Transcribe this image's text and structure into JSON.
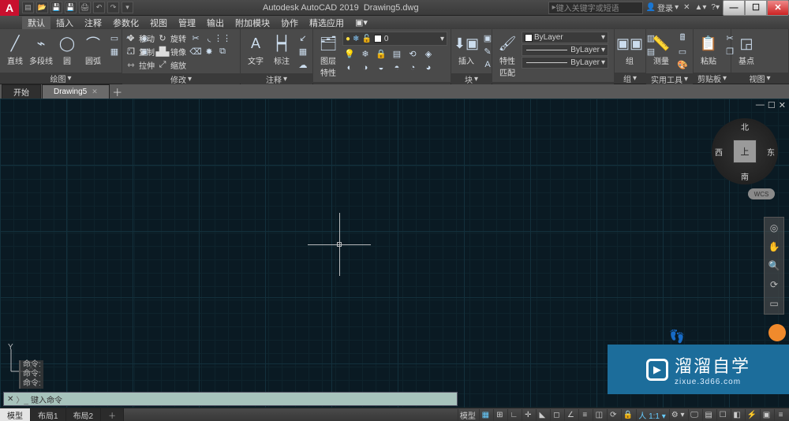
{
  "title": {
    "app": "Autodesk AutoCAD 2019",
    "doc": "Drawing5.dwg"
  },
  "search": {
    "placeholder": "键入关键字或短语"
  },
  "user": {
    "login": "登录"
  },
  "menubar": [
    "默认",
    "插入",
    "注释",
    "参数化",
    "视图",
    "管理",
    "输出",
    "附加模块",
    "协作",
    "精选应用"
  ],
  "menubar_active": 0,
  "ribbon": {
    "draw": {
      "title": "绘图",
      "line": "直线",
      "polyline": "多段线",
      "circle": "圆",
      "arc": "圆弧"
    },
    "modify": {
      "title": "修改",
      "move": "移动",
      "rotate": "旋转",
      "copy": "复制",
      "mirror": "镜像",
      "stretch": "拉伸",
      "scale": "缩放"
    },
    "annotate": {
      "title": "注释",
      "text": "文字",
      "dim": "标注",
      "table": "表格"
    },
    "layers": {
      "title": "图层",
      "props": "图层\n特性",
      "current": "0"
    },
    "block": {
      "title": "块",
      "insert": "插入"
    },
    "props": {
      "title": "特性",
      "match": "特性\n匹配",
      "layer": "ByLayer",
      "ltype": "ByLayer",
      "lweight": "ByLayer"
    },
    "group": {
      "title": "组",
      "group": "组"
    },
    "util": {
      "title": "实用工具",
      "measure": "测量"
    },
    "clip": {
      "title": "剪贴板",
      "paste": "粘贴"
    },
    "view": {
      "title": "视图",
      "base": "基点"
    }
  },
  "tabs": {
    "start": "开始",
    "doc": "Drawing5"
  },
  "viewcube": {
    "top": "北",
    "right": "东",
    "bottom": "南",
    "left": "西",
    "face": "上",
    "wcs": "WCS"
  },
  "model_tabs": {
    "model": "模型",
    "layout1": "布局1",
    "layout2": "布局2"
  },
  "command": {
    "history_label": "命令:",
    "prompt": "键入命令"
  },
  "status_model": "模型",
  "watermark": {
    "name": "溜溜自学",
    "url": "zixue.3d66.com"
  }
}
